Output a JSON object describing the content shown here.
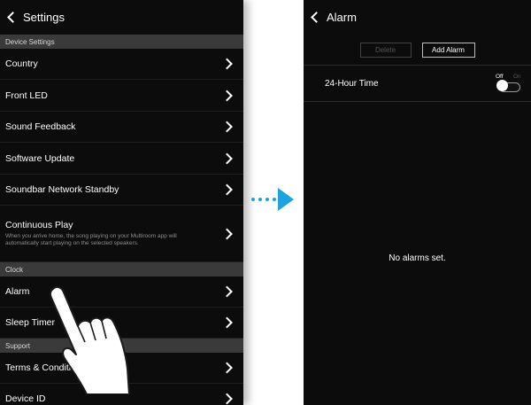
{
  "settings_screen": {
    "title": "Settings",
    "sections": [
      {
        "header": "Device Settings",
        "items": [
          {
            "label": "Country"
          },
          {
            "label": "Front LED"
          },
          {
            "label": "Sound Feedback"
          },
          {
            "label": "Software Update"
          },
          {
            "label": "Soundbar Network Standby"
          },
          {
            "label": "Continuous Play",
            "description": "When you arrive home, the song playing on your Multiroom app will automatically start playing on the selected speakers."
          }
        ]
      },
      {
        "header": "Clock",
        "items": [
          {
            "label": "Alarm"
          },
          {
            "label": "Sleep Timer"
          }
        ]
      },
      {
        "header": "Support",
        "items": [
          {
            "label": "Terms & Conditions"
          },
          {
            "label": "Device ID"
          }
        ]
      }
    ]
  },
  "alarm_screen": {
    "title": "Alarm",
    "delete_label": "Delete",
    "add_label": "Add Alarm",
    "time_format_label": "24-Hour Time",
    "toggle_off_label": "Off",
    "toggle_on_label": "On",
    "toggle_state": "off",
    "empty_message": "No alarms set."
  },
  "colors": {
    "screen_bg": "#0c0c0c",
    "section_bg": "#3a3a3a",
    "arrow": "#1fa3de"
  }
}
